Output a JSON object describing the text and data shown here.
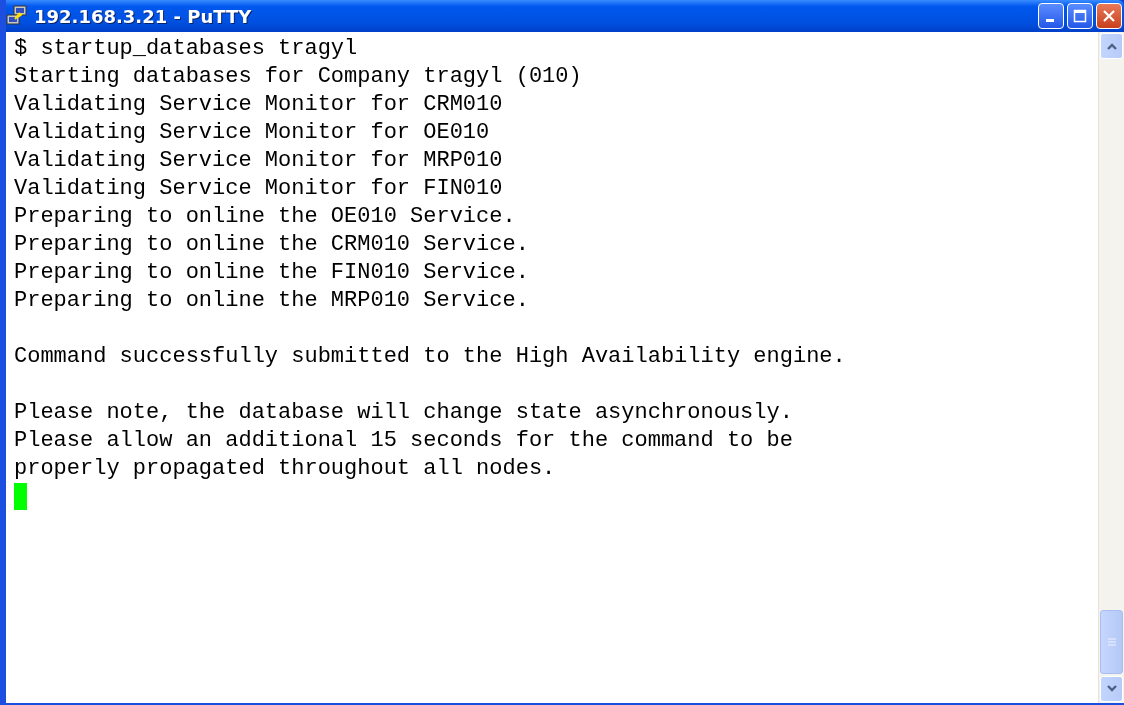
{
  "window": {
    "title": "192.168.3.21 - PuTTY"
  },
  "terminal": {
    "blocks": [
      [
        "$ startup_databases tragyl",
        "Starting databases for Company tragyl (010)",
        "Validating Service Monitor for CRM010",
        "Validating Service Monitor for OE010",
        "Validating Service Monitor for MRP010",
        "Validating Service Monitor for FIN010",
        "Preparing to online the OE010 Service.",
        "Preparing to online the CRM010 Service.",
        "Preparing to online the FIN010 Service.",
        "Preparing to online the MRP010 Service."
      ],
      [
        "Command successfully submitted to the High Availability engine."
      ],
      [
        "Please note, the database will change state asynchronously.",
        "Please allow an additional 15 seconds for the command to be",
        "properly propagated throughout all nodes."
      ]
    ]
  }
}
